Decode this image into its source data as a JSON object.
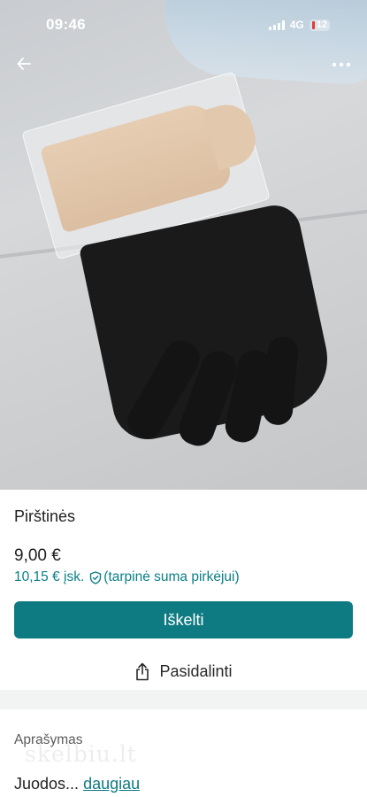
{
  "status_bar": {
    "time": "09:46",
    "network": "4G",
    "battery": "12"
  },
  "nav": {
    "back_icon": "arrow-left-icon",
    "more_icon": "more-horizontal-icon"
  },
  "listing": {
    "title": "Pirštinės",
    "price": "9,00 €",
    "total_price": "10,15 € įsk.",
    "total_note": "(tarpinė suma pirkėjui)"
  },
  "actions": {
    "primary_label": "Iškelti",
    "share_label": "Pasidalinti",
    "share_icon": "share-icon"
  },
  "description": {
    "label": "Aprašymas",
    "text": "Juodos...",
    "more_link": "daugiau",
    "watermark": "skelbiu.lt"
  },
  "colors": {
    "accent": "#0e7a81",
    "price_total": "#0a7f86"
  }
}
